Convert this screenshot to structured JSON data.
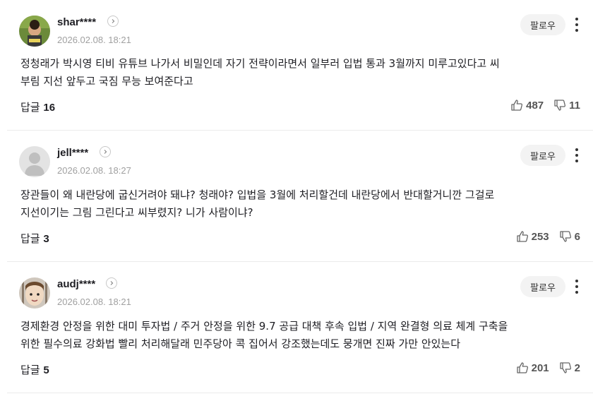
{
  "follow_label": "팔로우",
  "reply_label": "답글",
  "comments": [
    {
      "username": "shar****",
      "timestamp": "2026.02.08. 18:21",
      "text_line1": "정청래가 박시영 티비 유튜브 나가서 비밀인데 자기 전략이라면서 일부러 입법 통과 3월까지 미루고있다고 씨",
      "text_line2": "부림 지선 앞두고 국짐 무능 보여준다고",
      "reply_count": "16",
      "likes": "487",
      "dislikes": "11"
    },
    {
      "username": "jell****",
      "timestamp": "2026.02.08. 18:27",
      "text_line1": "장관들이 왜 내란당에 굽신거려야 돼냐? 청래야? 입법을 3월에 처리할건데 내란당에서 반대할거니깐 그걸로",
      "text_line2": "지선이기는 그림 그린다고 씨부렸지? 니가 사람이냐?",
      "reply_count": "3",
      "likes": "253",
      "dislikes": "6"
    },
    {
      "username": "audj****",
      "timestamp": "2026.02.08. 18:21",
      "text_line1": "경제환경 안정을 위한 대미 투자법 / 주거 안정을 위한 9.7 공급 대책 후속 입법 / 지역 완결형 의료 체계 구축을",
      "text_line2": "위한 필수의료 강화법 빨리 처리해달래 민주당아 콕 집어서 강조했는데도 뭉개면 진짜 가만 안있는다",
      "reply_count": "5",
      "likes": "201",
      "dislikes": "2"
    }
  ],
  "icons": {
    "profile_arrow": "chevron-right-icon",
    "more": "more-vertical-icon",
    "like": "thumbs-up-icon",
    "dislike": "thumbs-down-icon"
  }
}
